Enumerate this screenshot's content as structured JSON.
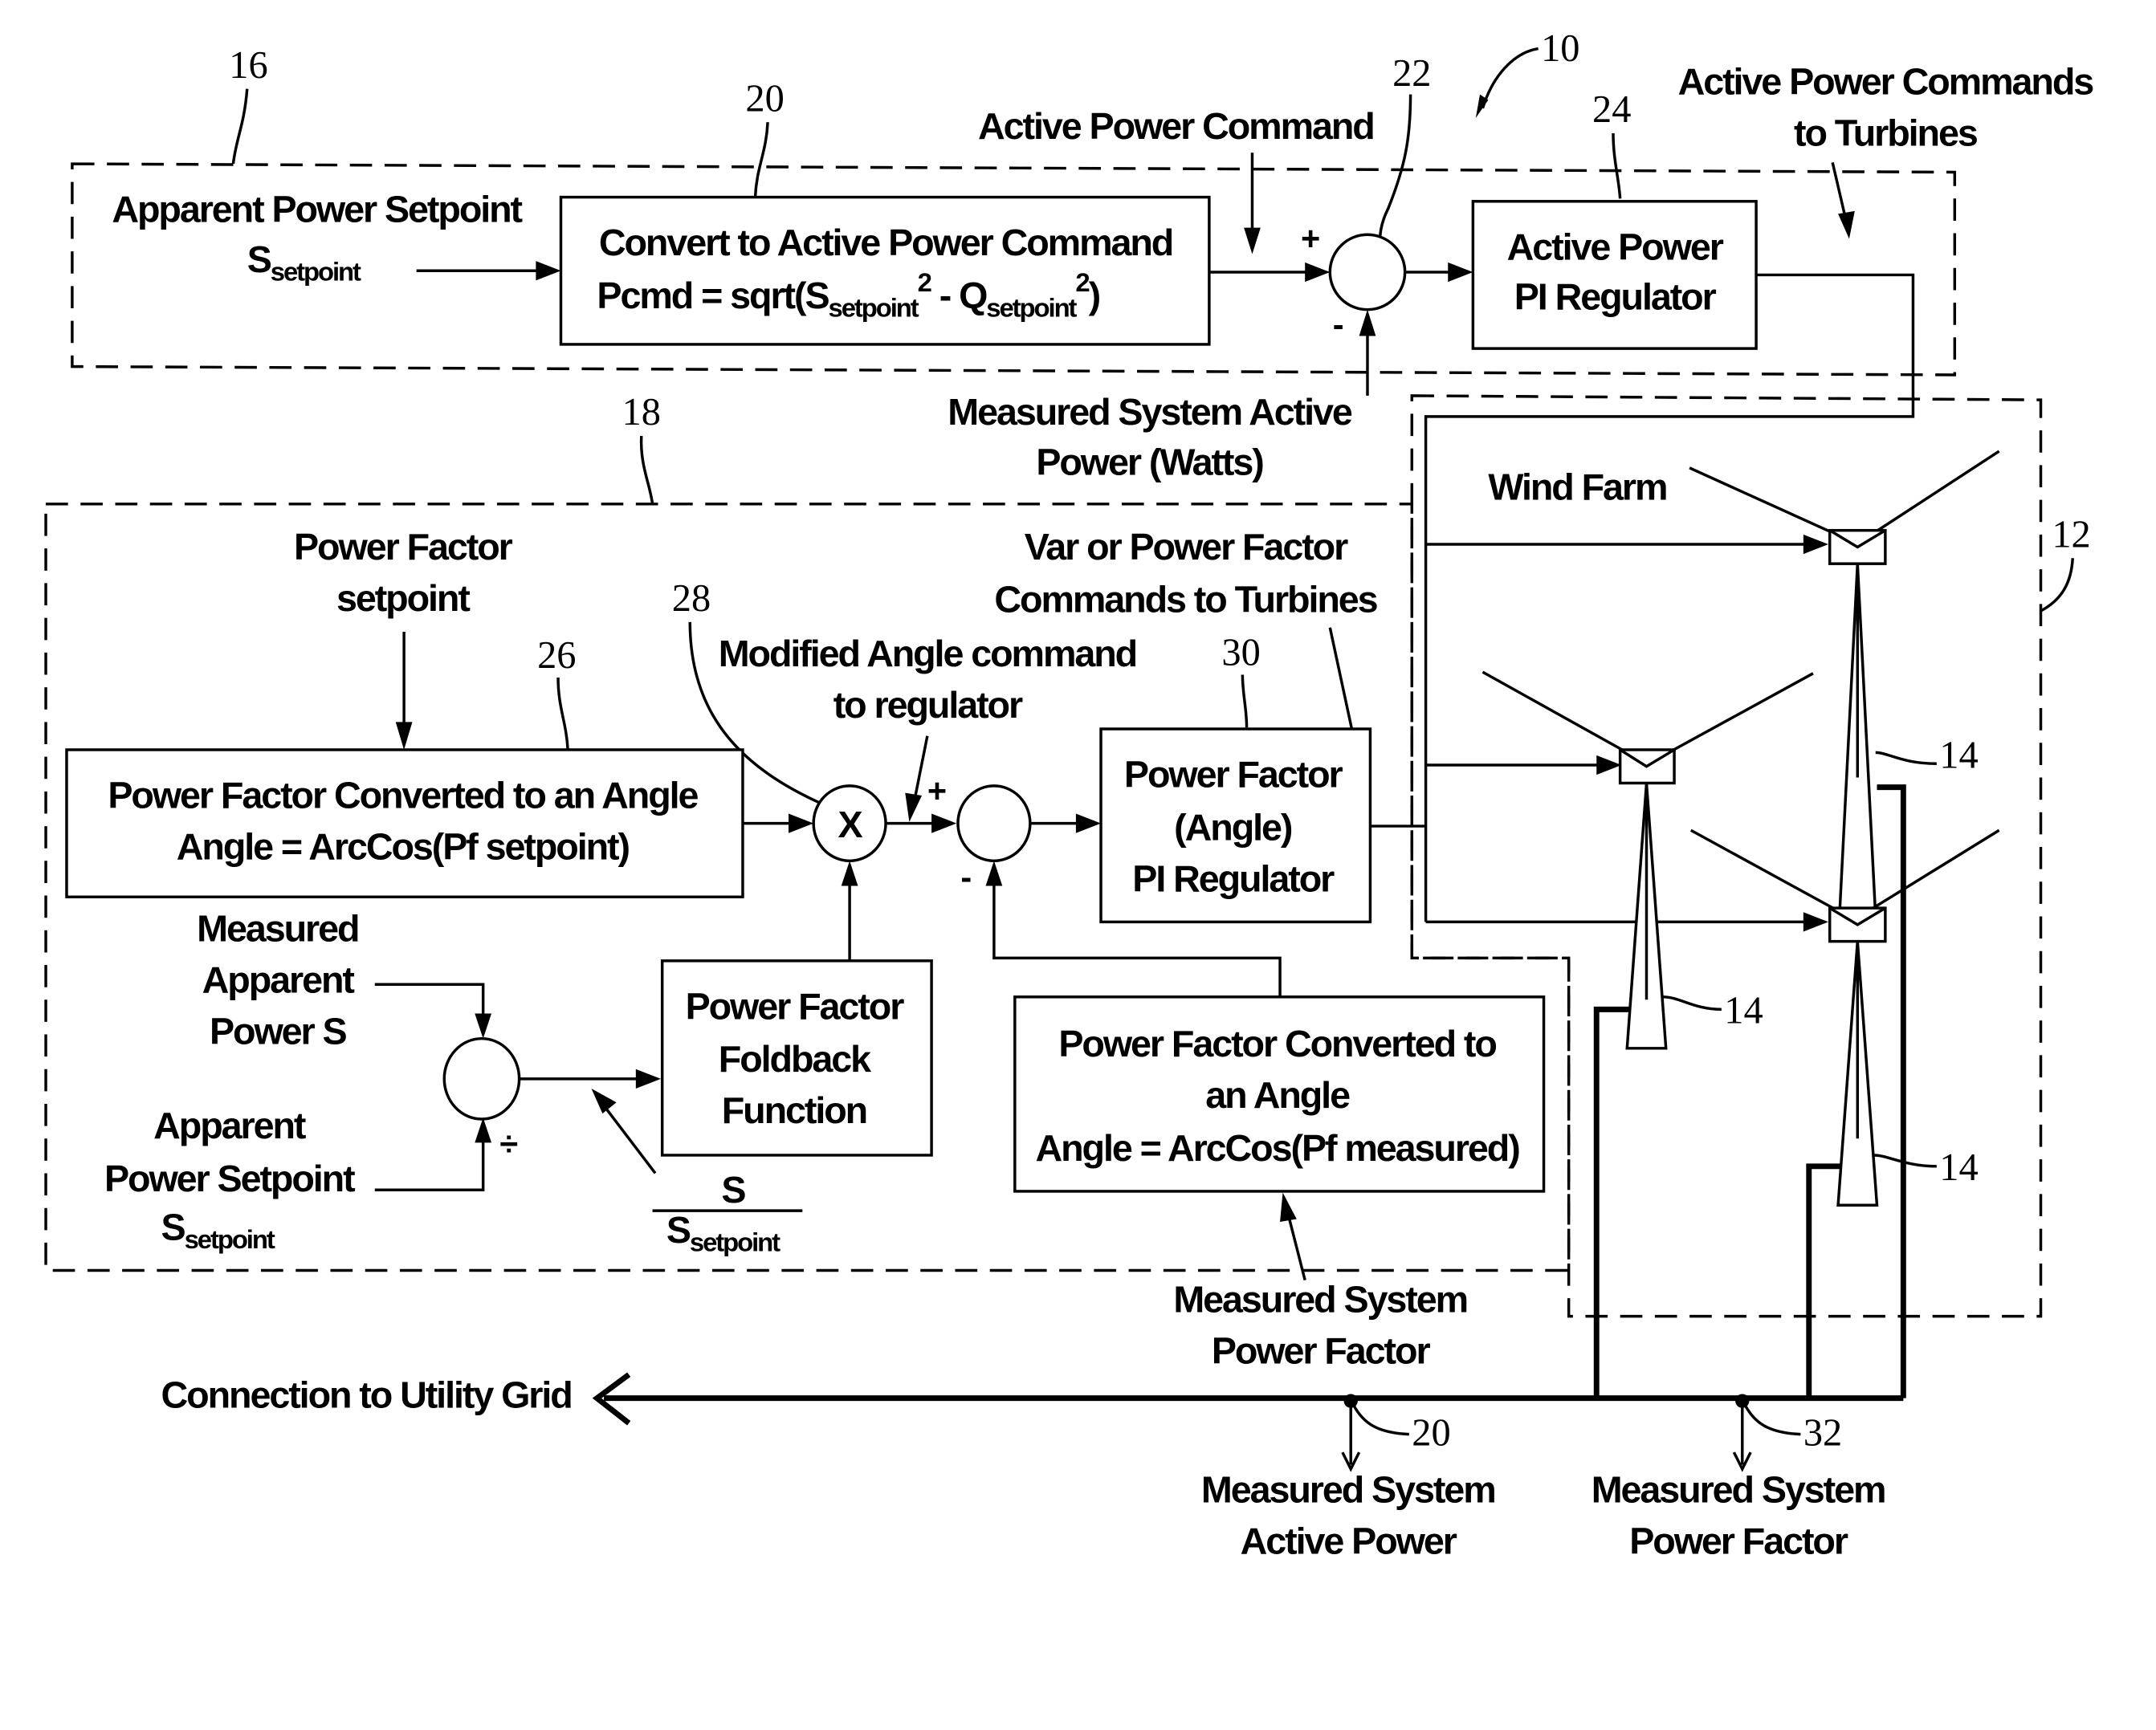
{
  "refs": {
    "system": "10",
    "wind_farm": "12",
    "turbine": "14",
    "active_controller": "16",
    "pf_controller": "18",
    "convert_block": "20",
    "sum_active": "22",
    "active_pi": "24",
    "pf_convert_setpoint": "26",
    "multiplier": "28",
    "pf_pi": "30",
    "measure_active": "20",
    "measure_pf": "32"
  },
  "active_loop": {
    "input_label_line1": "Apparent Power Setpoint",
    "input_label_S": "S",
    "input_label_sub": "setpoint",
    "convert_title": "Convert to Active Power Command",
    "formula_prefix": "Pcmd = sqrt(S",
    "formula_sub1": "setpoint",
    "formula_sup1": "2",
    "formula_mid": " - Q",
    "formula_sub2": "setpoint",
    "formula_sup2": "2",
    "formula_suffix": ")",
    "command_label": "Active Power Command",
    "plus": "+",
    "minus": "-",
    "pi_line1": "Active Power",
    "pi_line2": "PI Regulator",
    "feedback_line1": "Measured System Active",
    "feedback_line2": "Power (Watts)",
    "output_line1": "Active Power Commands",
    "output_line2": "to Turbines"
  },
  "pf_loop": {
    "setpoint_line1": "Power Factor",
    "setpoint_line2": "setpoint",
    "convert_line1": "Power Factor Converted to an Angle",
    "convert_line2": "Angle = ArcCos(Pf setpoint)",
    "multiplier_symbol": "X",
    "modified_line1": "Modified Angle command",
    "modified_line2": "to regulator",
    "plus": "+",
    "minus": "-",
    "output_line1": "Var or Power Factor",
    "output_line2": "Commands to Turbines",
    "pi_line1": "Power Factor",
    "pi_line2": "(Angle)",
    "pi_line3": "PI Regulator",
    "measured_s_line1": "Measured",
    "measured_s_line2": "Apparent",
    "measured_s_line3": "Power S",
    "setpoint_s_line1": "Apparent",
    "setpoint_s_line2": "Power Setpoint",
    "setpoint_s_S": "S",
    "setpoint_s_sub": "setpoint",
    "divide_symbol": "÷",
    "ratio_num": "S",
    "ratio_den_S": "S",
    "ratio_den_sub": "setpoint",
    "foldback_line1": "Power Factor",
    "foldback_line2": "Foldback",
    "foldback_line3": "Function",
    "measured_convert_line1": "Power Factor Converted to",
    "measured_convert_line2": "an Angle",
    "measured_convert_line3": "Angle = ArcCos(Pf measured)",
    "feedback_line1": "Measured System",
    "feedback_line2": "Power Factor"
  },
  "wind_farm": {
    "label": "Wind Farm"
  },
  "grid": {
    "label": "Connection to Utility Grid",
    "measure_active_line1": "Measured System",
    "measure_active_line2": "Active Power",
    "measure_pf_line1": "Measured System",
    "measure_pf_line2": "Power Factor"
  }
}
